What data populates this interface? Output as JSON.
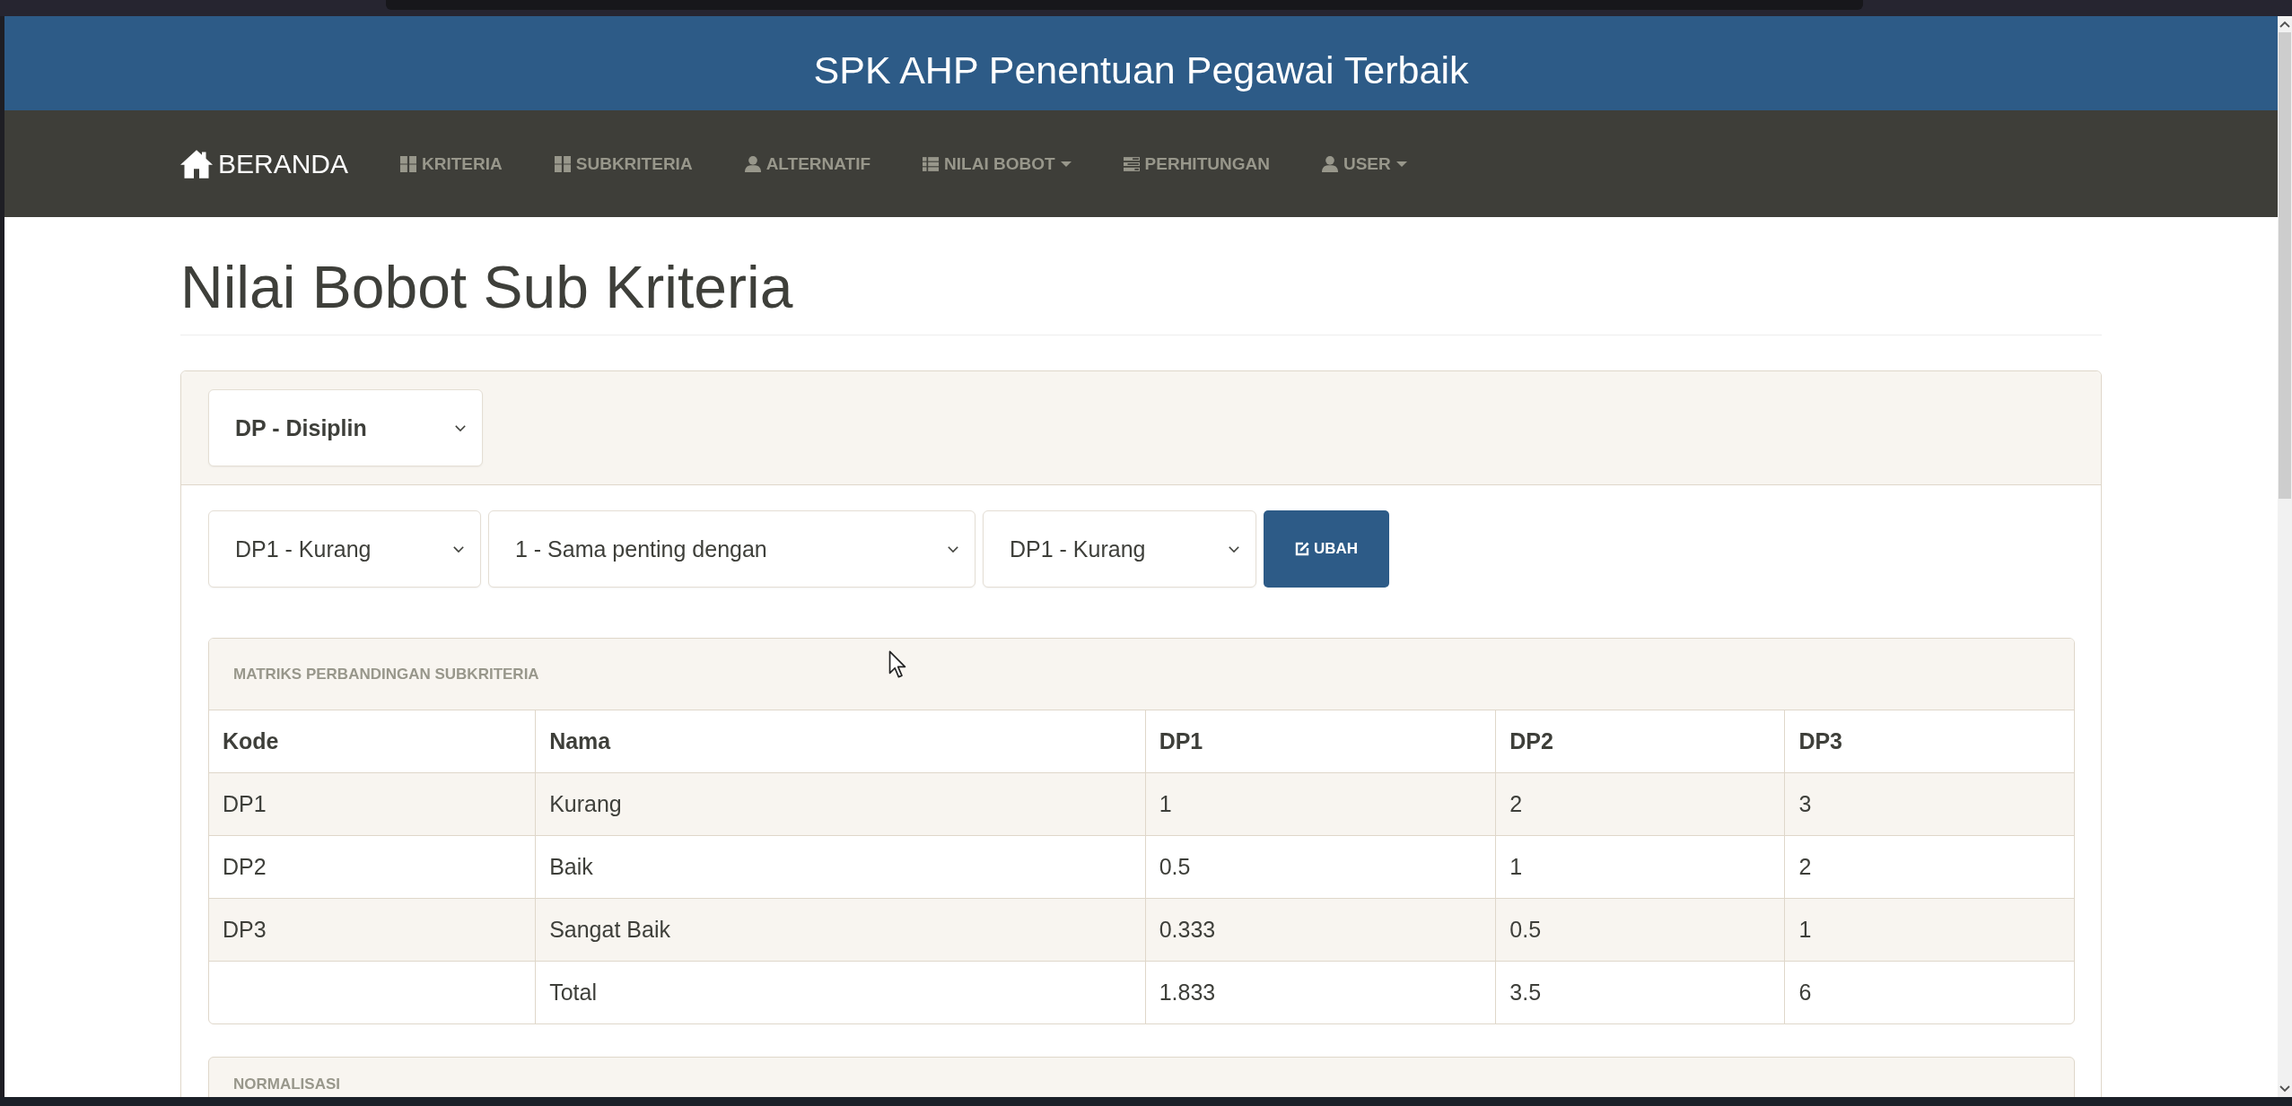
{
  "header": {
    "title": "SPK AHP Penentuan Pegawai Terbaik"
  },
  "navbar": {
    "brand": "BERANDA",
    "items": [
      {
        "label": "KRITERIA",
        "dropdown": false
      },
      {
        "label": "SUBKRITERIA",
        "dropdown": false
      },
      {
        "label": "ALTERNATIF",
        "dropdown": false
      },
      {
        "label": "NILAI BOBOT",
        "dropdown": true
      },
      {
        "label": "PERHITUNGAN",
        "dropdown": false
      },
      {
        "label": "USER",
        "dropdown": true
      }
    ]
  },
  "page_title": "Nilai Bobot Sub Kriteria",
  "criteria_select": {
    "value": "DP - Disiplin"
  },
  "comparison_form": {
    "selects": [
      {
        "value": "DP1 - Kurang"
      },
      {
        "value": "1 - Sama penting dengan"
      },
      {
        "value": "DP1 - Kurang"
      }
    ],
    "button": "UBAH"
  },
  "matrix_panel": {
    "heading": "MATRIKS PERBANDINGAN SUBKRITERIA",
    "columns": [
      "Kode",
      "Nama",
      "DP1",
      "DP2",
      "DP3"
    ],
    "rows": [
      {
        "kode": "DP1",
        "nama": "Kurang",
        "values": [
          "1",
          "2",
          "3"
        ]
      },
      {
        "kode": "DP2",
        "nama": "Baik",
        "values": [
          "0.5",
          "1",
          "2"
        ]
      },
      {
        "kode": "DP3",
        "nama": "Sangat Baik",
        "values": [
          "0.333",
          "0.5",
          "1"
        ]
      }
    ],
    "total": {
      "label": "Total",
      "values": [
        "1.833",
        "3.5",
        "6"
      ]
    }
  },
  "normalization_panel": {
    "heading": "NORMALISASI"
  }
}
